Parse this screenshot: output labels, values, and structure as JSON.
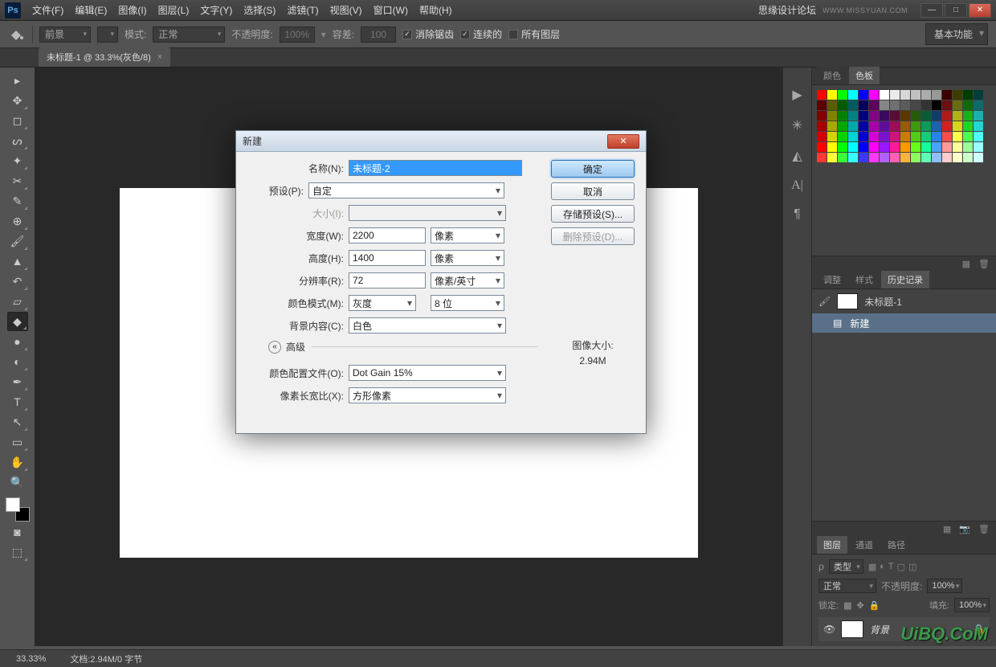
{
  "app": {
    "logo": "Ps",
    "brand_text": "思缘设计论坛",
    "brand_url": "WWW.MISSYUAN.COM"
  },
  "menu": [
    "文件(F)",
    "编辑(E)",
    "图像(I)",
    "图层(L)",
    "文字(Y)",
    "选择(S)",
    "滤镜(T)",
    "视图(V)",
    "窗口(W)",
    "帮助(H)"
  ],
  "optbar": {
    "fill_label": "前景",
    "mode_label": "模式:",
    "mode_value": "正常",
    "opacity_label": "不透明度:",
    "opacity_value": "100%",
    "tolerance_label": "容差:",
    "tolerance_value": "100",
    "antialias": "消除锯齿",
    "contiguous": "连续的",
    "all_layers": "所有图层",
    "workspace": "基本功能"
  },
  "doc_tab": "未标题-1 @ 33.3%(灰色/8)",
  "panels": {
    "color_tabs": [
      "颜色",
      "色板"
    ],
    "adjust_tabs": [
      "调整",
      "样式",
      "历史记录"
    ],
    "history_doc": "未标题-1",
    "history_step": "新建",
    "layer_tabs": [
      "图层",
      "通道",
      "路径"
    ],
    "layer_kind": "类型",
    "blend_mode": "正常",
    "opacity_lbl": "不透明度:",
    "opacity_val": "100%",
    "lock_lbl": "锁定:",
    "fill_lbl": "填充:",
    "fill_val": "100%",
    "bg_layer": "背景"
  },
  "status": {
    "zoom": "33.33%",
    "doc": "文档:2.94M/0 字节"
  },
  "dialog": {
    "title": "新建",
    "ok": "确定",
    "cancel": "取消",
    "save_preset": "存储预设(S)...",
    "del_preset": "删除预设(D)...",
    "name_lbl": "名称(N):",
    "name_val": "未标题-2",
    "preset_lbl": "预设(P):",
    "preset_val": "自定",
    "size_lbl": "大小(I):",
    "width_lbl": "宽度(W):",
    "width_val": "2200",
    "width_unit": "像素",
    "height_lbl": "高度(H):",
    "height_val": "1400",
    "height_unit": "像素",
    "res_lbl": "分辨率(R):",
    "res_val": "72",
    "res_unit": "像素/英寸",
    "mode_lbl": "颜色模式(M):",
    "mode_val": "灰度",
    "depth_val": "8 位",
    "bg_lbl": "背景内容(C):",
    "bg_val": "白色",
    "adv": "高级",
    "profile_lbl": "颜色配置文件(O):",
    "profile_val": "Dot Gain 15%",
    "par_lbl": "像素长宽比(X):",
    "par_val": "方形像素",
    "imgsize_lbl": "图像大小:",
    "imgsize_val": "2.94M"
  },
  "swatch_colors": [
    "#ff0000",
    "#ffff00",
    "#00ff00",
    "#00ffff",
    "#0000ff",
    "#ff00ff",
    "#ffffff",
    "#ebebeb",
    "#d6d6d6",
    "#c2c2c2",
    "#adadad",
    "#999999",
    "#3d0000",
    "#3d3d00",
    "#003d00",
    "#003d3d",
    "#5c0000",
    "#5c5c00",
    "#005c00",
    "#005c5c",
    "#00005c",
    "#5c005c",
    "#858585",
    "#707070",
    "#5c5c5c",
    "#474747",
    "#333333",
    "#000000",
    "#6b0f0f",
    "#6b6b0f",
    "#0f6b0f",
    "#0f6b6b",
    "#820000",
    "#828200",
    "#008200",
    "#008282",
    "#000082",
    "#820082",
    "#380a5c",
    "#5c0a38",
    "#5c3800",
    "#255c0a",
    "#0a5c38",
    "#133b6c",
    "#b01a1a",
    "#b0b01a",
    "#1ab01a",
    "#1ab0b0",
    "#a80000",
    "#a8a800",
    "#00a800",
    "#00a8a8",
    "#0000a8",
    "#a800a8",
    "#5c0f99",
    "#990f5c",
    "#995c00",
    "#3d990f",
    "#0f995c",
    "#1e61b3",
    "#d62020",
    "#d6d620",
    "#20d620",
    "#20d6d6",
    "#d40000",
    "#d4d400",
    "#00d400",
    "#00d4d4",
    "#0000d4",
    "#d400d4",
    "#7a14cc",
    "#cc147a",
    "#cc7a00",
    "#52cc14",
    "#14cc7a",
    "#2882f0",
    "#ff4d4d",
    "#ffff4d",
    "#4dff4d",
    "#4dffff",
    "#ff0000",
    "#ffff00",
    "#00ff00",
    "#00ffff",
    "#0000ff",
    "#ff00ff",
    "#9819ff",
    "#ff1998",
    "#ff9800",
    "#66ff19",
    "#19ff98",
    "#4da0ff",
    "#ff9999",
    "#ffff99",
    "#99ff99",
    "#99ffff",
    "#ff3838",
    "#ffff38",
    "#38ff38",
    "#38ffff",
    "#3838ff",
    "#ff38ff",
    "#b260ff",
    "#ff60b2",
    "#ffb23d",
    "#8cff60",
    "#60ffb2",
    "#8cc0ff",
    "#ffcccc",
    "#ffffcc",
    "#ccffcc",
    "#ccffff"
  ],
  "watermark": {
    "main": "UiBQ.CoM"
  }
}
